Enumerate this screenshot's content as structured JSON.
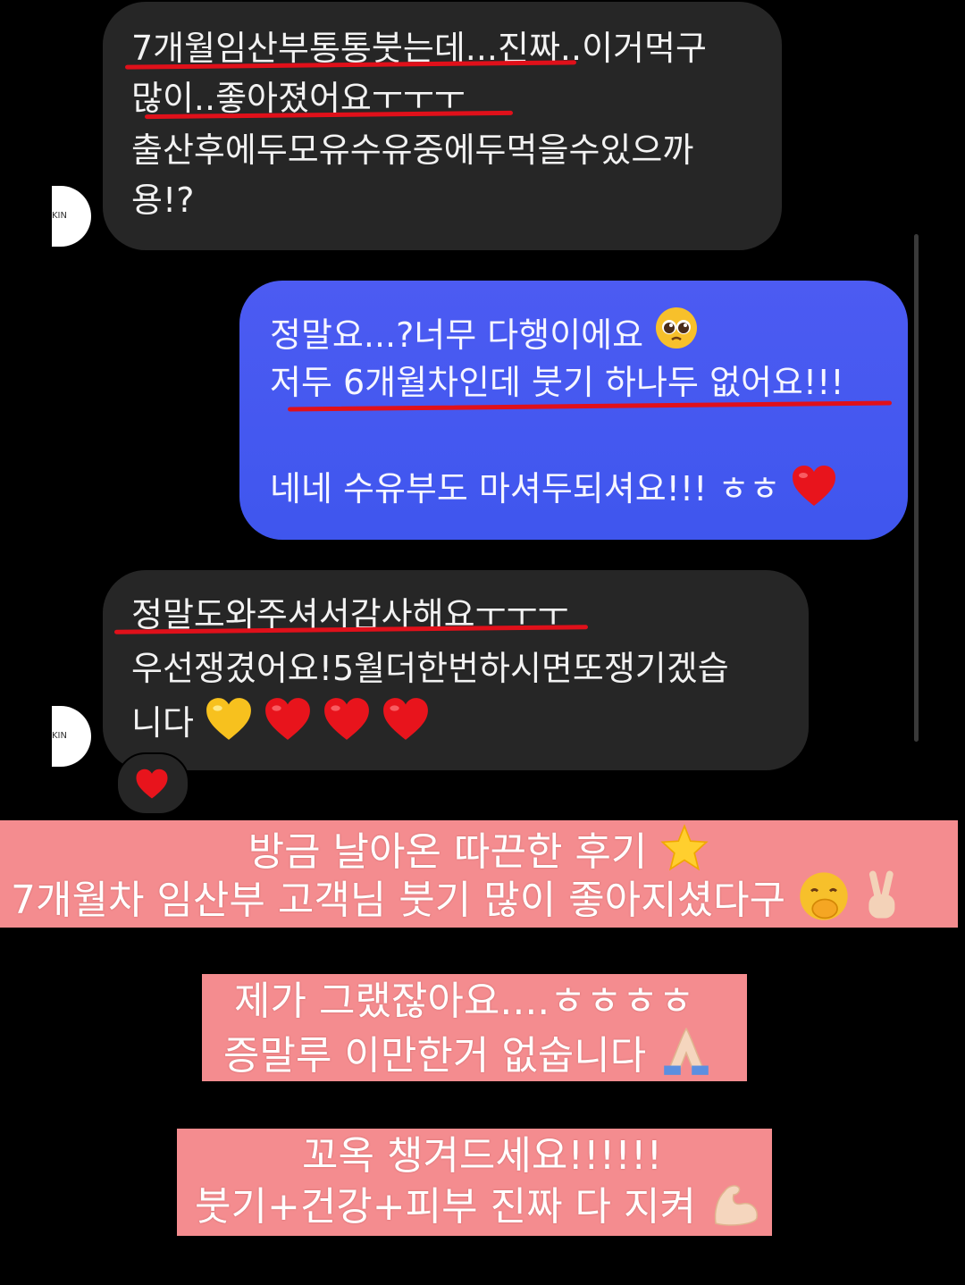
{
  "messages": [
    {
      "direction": "incoming",
      "lines": [
        "7개월임산부통통붓는데...진짜..이거먹구",
        "많이..좋아졌어요ㅜㅜㅜ",
        "출산후에두모유수유중에두먹을수있으까",
        "용!?"
      ]
    },
    {
      "direction": "outgoing",
      "lines": [
        "정말요...?너무 다행이에요",
        "저두 6개월차인데 붓기 하나두 없어요!!!",
        "",
        "네네 수유부도 마셔두되셔요!!! ㅎㅎ"
      ],
      "emojis": [
        "pleading-face-emoji",
        "red-heart-emoji"
      ]
    },
    {
      "direction": "incoming",
      "lines": [
        "정말도와주셔서감사해요ㅜㅜㅜ",
        "우선쟁겼어요!5월더한번하시면또쟁기겠습",
        "니다"
      ],
      "emojis": [
        "yellow-heart-emoji",
        "red-heart-emoji",
        "red-heart-emoji",
        "red-heart-emoji"
      ],
      "reaction": "red-heart-emoji"
    }
  ],
  "avatar_text": "KIN",
  "captions": [
    {
      "lines": [
        "방금 날아온 따끈한 후기",
        "7개월차 임산부 고객님 붓기 많이 좋아지셨다구"
      ],
      "emojis": [
        "star-emoji",
        "hand-over-mouth-emoji",
        "victory-hand-emoji"
      ]
    },
    {
      "lines": [
        "제가 그랬잖아요....ㅎㅎㅎㅎ",
        "증말루 이만한거 없숩니다"
      ],
      "emojis": [
        "folded-hands-emoji"
      ]
    },
    {
      "lines": [
        "꼬옥 챙겨드세요!!!!!!",
        "붓기+건강+피부 진짜 다 지켜"
      ],
      "emojis": [
        "flexed-biceps-emoji"
      ]
    }
  ],
  "colors": {
    "background": "#000000",
    "incoming_bubble": "#262626",
    "outgoing_bubble": "#4252ef",
    "underline_mark": "#e0101a",
    "caption_banner": "#f48c8f"
  }
}
